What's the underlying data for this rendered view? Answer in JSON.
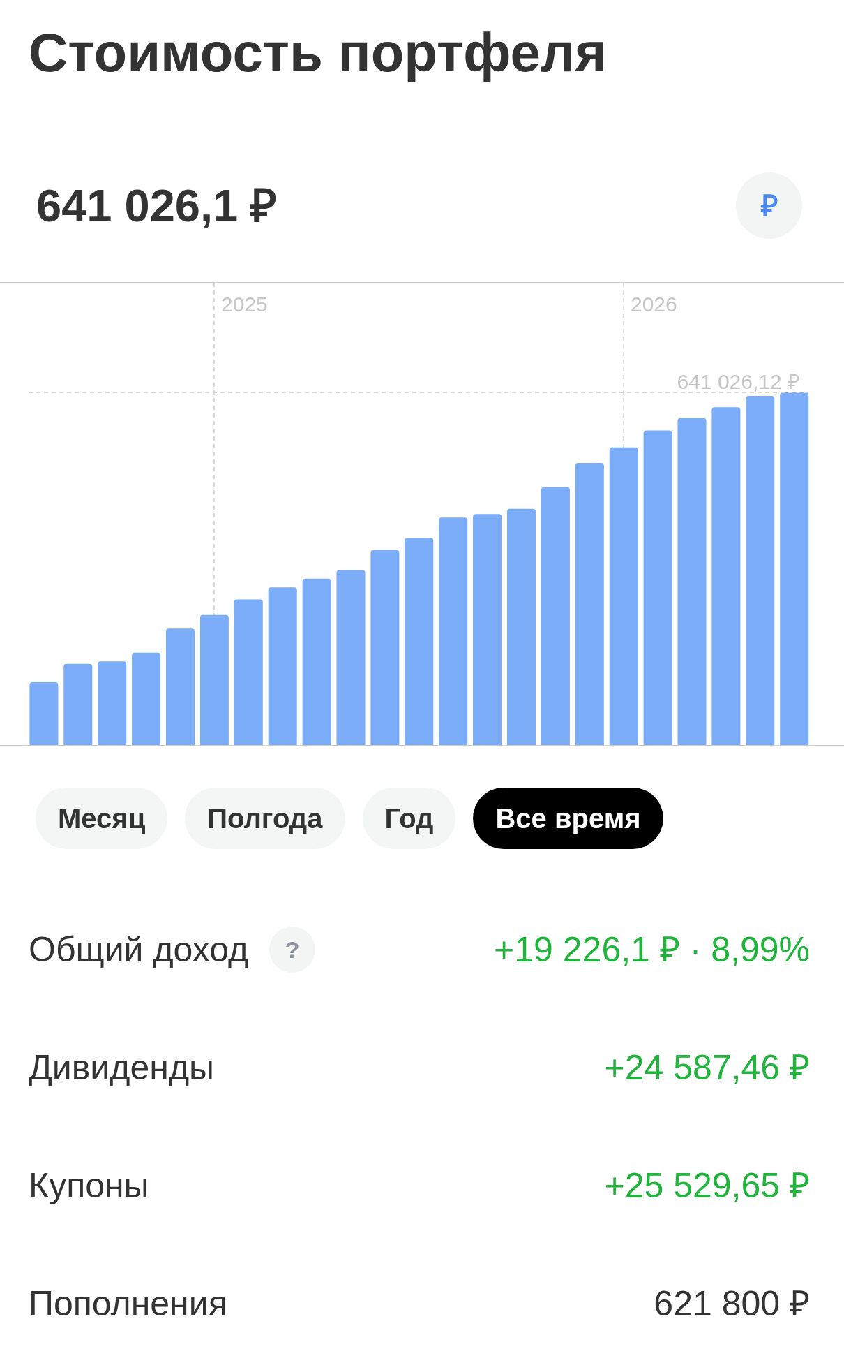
{
  "header": {
    "title": "Стоимость портфеля"
  },
  "portfolio": {
    "total": "641 026,1 ₽",
    "currency_button": "₽"
  },
  "chart": {
    "year_labels": [
      "2025",
      "2026"
    ],
    "max_label": "641 026,12 ₽"
  },
  "periods": [
    {
      "label": "Месяц",
      "selected": false
    },
    {
      "label": "Полгода",
      "selected": false
    },
    {
      "label": "Год",
      "selected": false
    },
    {
      "label": "Все время",
      "selected": true
    }
  ],
  "stats": [
    {
      "label": "Общий доход",
      "help": "?",
      "value": "+19 226,1 ₽ · 8,99%",
      "positive": true
    },
    {
      "label": "Дивиденды",
      "value": "+24 587,46 ₽",
      "positive": true
    },
    {
      "label": "Купоны",
      "value": "+25 529,65 ₽",
      "positive": true
    },
    {
      "label": "Пополнения",
      "value": "621 800 ₽",
      "positive": false
    }
  ]
}
